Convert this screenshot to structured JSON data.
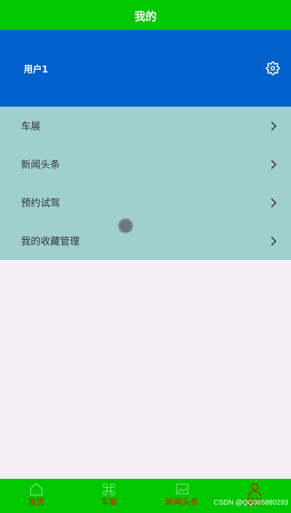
{
  "header": {
    "title": "我的"
  },
  "profile": {
    "username": "用户1",
    "settings_icon": "gear-icon"
  },
  "menu": {
    "items": [
      {
        "label": "车展",
        "icon": "chevron-right-icon"
      },
      {
        "label": "新闻头条",
        "icon": "chevron-right-icon"
      },
      {
        "label": "预约试驾",
        "icon": "chevron-right-icon"
      },
      {
        "label": "我的收藏管理",
        "icon": "chevron-right-icon"
      }
    ]
  },
  "tabbar": {
    "tabs": [
      {
        "label": "首页",
        "icon": "home-icon"
      },
      {
        "label": "车展",
        "icon": "command-icon"
      },
      {
        "label": "新闻头条",
        "icon": "image-icon"
      },
      {
        "label": "我的",
        "icon": "user-icon",
        "active": true
      }
    ]
  },
  "watermark": "CSDN @QQ365880293",
  "colors": {
    "header_bg": "#00c800",
    "profile_bg": "#0060cc",
    "menu_bg": "#a0cfd0",
    "tab_label": "#cc1a00"
  }
}
